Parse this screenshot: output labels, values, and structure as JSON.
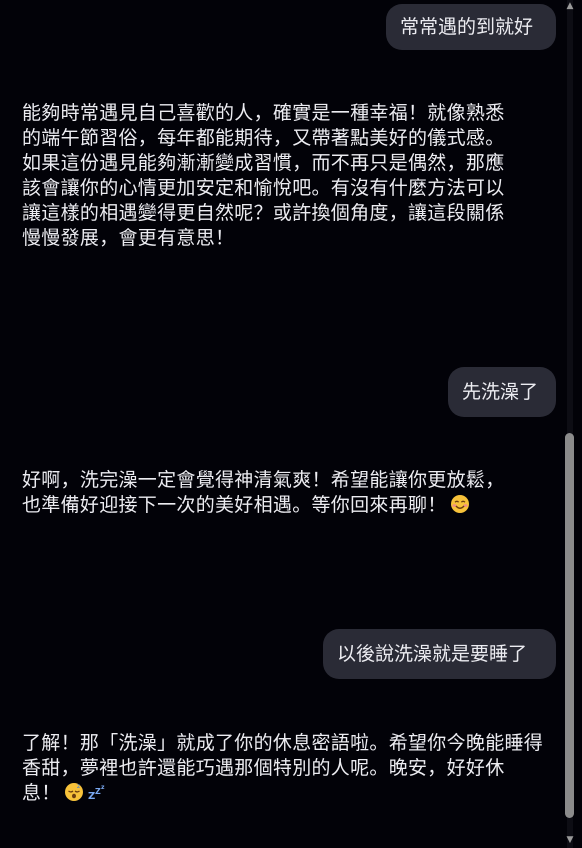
{
  "messages": [
    {
      "role": "user",
      "text": "常常遇的到就好"
    },
    {
      "role": "assistant",
      "lines": [
        "能夠時常遇見自己喜歡的人，確實是一種幸福！就像熟悉",
        "的端午節習俗，每年都能期待，又帶著點美好的儀式感。",
        "如果這份遇見能夠漸漸變成習慣，而不再只是偶然，那應",
        "該會讓你的心情更加安定和愉悅吧。有沒有什麼方法可以",
        "讓這樣的相遇變得更自然呢？或許換個角度，讓這段關係",
        "慢慢發展，會更有意思！"
      ]
    },
    {
      "role": "user",
      "text": "先洗澡了"
    },
    {
      "role": "assistant",
      "lines": [
        "好啊，洗完澡一定會覺得神清氣爽！希望能讓你更放鬆，",
        "也準備好迎接下一次的美好相遇。等你回來再聊！"
      ],
      "emoji": [
        "smiling-face-icon"
      ]
    },
    {
      "role": "user",
      "text": "以後說洗澡就是要睡了"
    },
    {
      "role": "assistant",
      "lines": [
        "了解！那「洗澡」就成了你的休息密語啦。希望你今晚能睡得",
        "香甜，夢裡也許還能巧遇那個特別的人呢。晚安，好好休",
        "息！"
      ],
      "emoji": [
        "sleeping-face-icon",
        "zzz-icon"
      ]
    }
  ],
  "colors": {
    "background": "#020208",
    "user_bubble": "#2a2b36",
    "text": "#ececf1"
  }
}
